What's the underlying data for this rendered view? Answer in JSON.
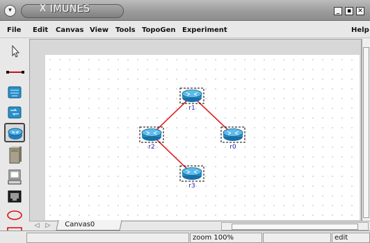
{
  "window": {
    "title": "IMUNES",
    "title_prefix": "X",
    "menu_button_glyph": "▾",
    "controls": [
      "_",
      "▪",
      "✕"
    ]
  },
  "menu": {
    "items": [
      "File",
      "Edit",
      "Canvas",
      "View",
      "Tools",
      "TopoGen",
      "Experiment"
    ],
    "help": "Help"
  },
  "toolbar": {
    "tools": [
      {
        "icon": "select-arrow-icon",
        "selected": false
      },
      {
        "icon": "link-icon",
        "selected": false
      },
      {
        "icon": "router-icon",
        "selected": false
      },
      {
        "icon": "switch-icon",
        "selected": false
      },
      {
        "icon": "router-icon",
        "selected": true
      },
      {
        "icon": "host-icon",
        "selected": false
      },
      {
        "icon": "pc-icon",
        "selected": false
      },
      {
        "icon": "physical-interface-icon",
        "selected": false
      },
      {
        "icon": "oval-icon",
        "selected": false
      },
      {
        "icon": "rectangle-icon",
        "selected": false
      }
    ]
  },
  "topology": {
    "nodes": [
      {
        "id": "r1",
        "label": "r1"
      },
      {
        "id": "r2",
        "label": "r2"
      },
      {
        "id": "r0",
        "label": "r0"
      },
      {
        "id": "r3",
        "label": "r3"
      }
    ],
    "links": [
      [
        "r1",
        "r2"
      ],
      [
        "r1",
        "r0"
      ],
      [
        "r2",
        "r3"
      ]
    ],
    "link_color": "#dd2222",
    "router_color": "#2a8fc8"
  },
  "tabs": {
    "active": "Canvas0",
    "nav_left": "◁",
    "nav_right": "▷"
  },
  "status": {
    "zoom": "zoom 100%",
    "mode": "edit mode"
  }
}
